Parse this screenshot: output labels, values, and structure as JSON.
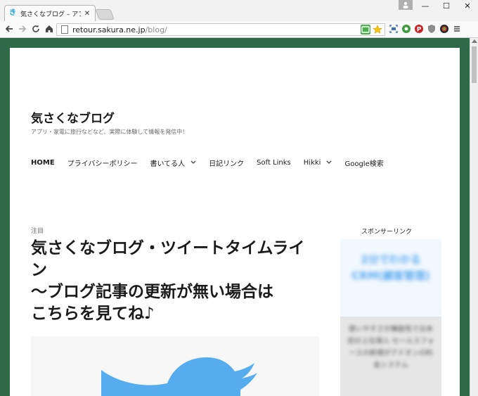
{
  "browser": {
    "tab_title": "気さくなブログ – アプリ・家電に",
    "tab_close": "✕",
    "url_host": "retour.sakura.ne.jp",
    "url_path": "/blog/",
    "window_minimize": "—",
    "window_maximize": "☐",
    "window_close": "✕"
  },
  "site": {
    "title": "気さくなブログ",
    "description": "アプリ・家電に旅行などなど、実際に体験して情報を発信中！"
  },
  "nav": {
    "items": [
      {
        "label": "HOME"
      },
      {
        "label": "プライバシーポリシー"
      },
      {
        "label": "書いてる人"
      },
      {
        "label": "日記リンク"
      },
      {
        "label": "Soft Links"
      },
      {
        "label": "Hikki"
      },
      {
        "label": "Google検索"
      }
    ]
  },
  "post": {
    "category": "注目",
    "title_line1": "気さくなブログ・ツイートタイムライン",
    "title_line2": "～ブログ記事の更新が無い場合は",
    "title_line3": "こちらを見てね♪"
  },
  "sidebar": {
    "title": "スポンサーリンク",
    "ad_headline": "2分でわかるCRM(顧客管理)",
    "ad_body": "使いやすさが機能性で日本初の上位導入 セールスフォースの新規がアドオンの料金システム"
  },
  "colors": {
    "frame_green": "#2e6a47",
    "twitter_blue": "#55acee",
    "ad_blue": "#5aa9ee"
  }
}
